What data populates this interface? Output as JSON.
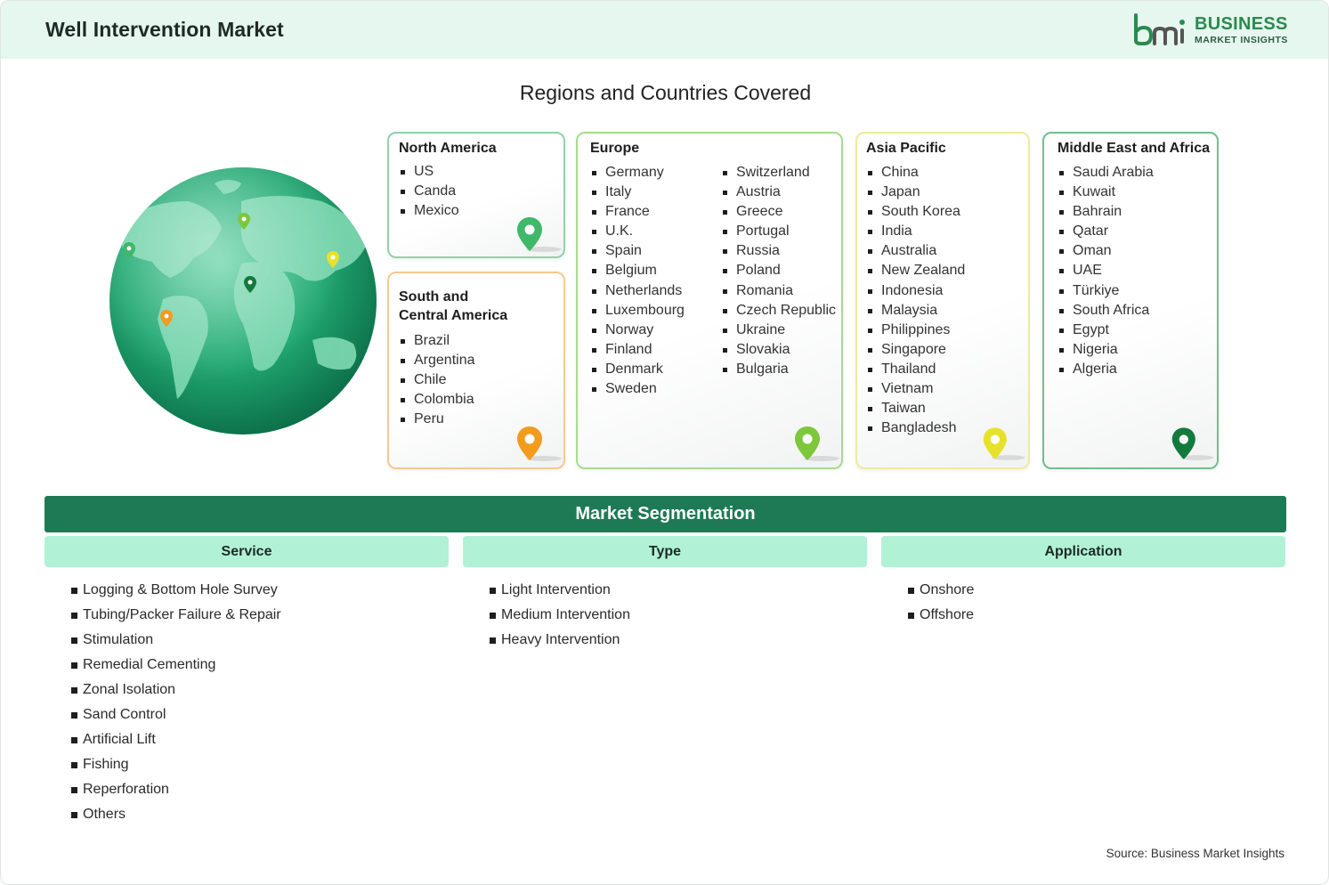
{
  "header": {
    "title": "Well Intervention Market"
  },
  "logo": {
    "brand_top": "BUSINESS",
    "brand_bottom": "MARKET INSIGHTS"
  },
  "regions": {
    "title": "Regions and Countries Covered",
    "north_america": {
      "name": "North America",
      "countries": [
        "US",
        "Canda",
        "Mexico"
      ],
      "pin_color": "#3fb86a"
    },
    "south_america": {
      "name": "South and Central America",
      "name_line1": "South and",
      "name_line2": "Central America",
      "countries": [
        "Brazil",
        "Argentina",
        "Chile",
        "Colombia",
        "Peru"
      ],
      "pin_color": "#f29b1e"
    },
    "europe": {
      "name": "Europe",
      "countries_col1": [
        "Germany",
        "Italy",
        "France",
        "U.K.",
        "Spain",
        "Belgium",
        "Netherlands",
        "Luxembourg",
        "Norway",
        "Finland",
        "Denmark",
        "Sweden"
      ],
      "countries_col2": [
        "Switzerland",
        "Austria",
        "Greece",
        "Portugal",
        "Russia",
        "Poland",
        "Romania",
        "Czech Republic",
        "Ukraine",
        "Slovakia",
        "Bulgaria"
      ],
      "pin_color": "#7cc83a"
    },
    "asia_pacific": {
      "name": "Asia Pacific",
      "countries": [
        "China",
        "Japan",
        "South Korea",
        "India",
        "Australia",
        "New Zealand",
        "Indonesia",
        "Malaysia",
        "Philippines",
        "Singapore",
        "Thailand",
        "Vietnam",
        "Taiwan",
        "Bangladesh"
      ],
      "pin_color": "#e6e22a"
    },
    "middle_east_africa": {
      "name": "Middle East and Africa",
      "countries": [
        "Saudi Arabia",
        "Kuwait",
        "Bahrain",
        "Qatar",
        "Oman",
        "UAE",
        "Türkiye",
        "South Africa",
        "Egypt",
        "Nigeria",
        "Algeria"
      ],
      "pin_color": "#137a3c"
    }
  },
  "segmentation": {
    "title": "Market Segmentation",
    "columns": [
      {
        "heading": "Service",
        "items": [
          "Logging & Bottom Hole Survey",
          "Tubing/Packer Failure & Repair",
          "Stimulation",
          "Remedial Cementing",
          "Zonal Isolation",
          "Sand Control",
          "Artificial Lift",
          "Fishing",
          "Reperforation",
          "Others"
        ]
      },
      {
        "heading": "Type",
        "items": [
          "Light Intervention",
          "Medium Intervention",
          "Heavy Intervention"
        ]
      },
      {
        "heading": "Application",
        "items": [
          "Onshore",
          "Offshore"
        ]
      }
    ]
  },
  "source": "Source: Business Market Insights",
  "colors": {
    "header_bg": "#e6f7ef",
    "segment_bar": "#1e7a55",
    "segment_head": "#b1f2d6",
    "brand_green": "#2b8a4e"
  }
}
